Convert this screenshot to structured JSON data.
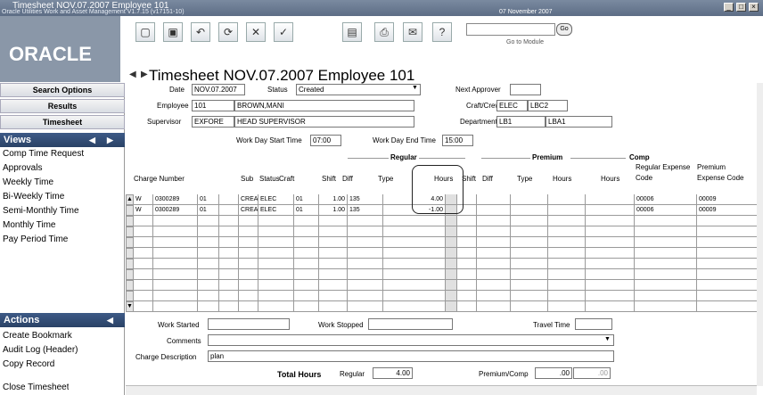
{
  "window": {
    "title": "Timesheet NOV.07.2007 Employee 101",
    "subtitle": "Oracle Utilities Work and Asset Management V1.7.15 (v17151-10)",
    "date": "07 November 2007"
  },
  "logo": "ORACLE",
  "toolbar": {
    "go_label": "Go",
    "go_to_module": "Go to Module"
  },
  "page_title": "Timesheet NOV.07.2007 Employee 101",
  "sidebar": {
    "buttons": [
      "Search Options",
      "Results",
      "Timesheet"
    ],
    "views_label": "Views",
    "views": [
      "Comp Time Request",
      "Approvals",
      "Weekly Time",
      "Bi-Weekly Time",
      "Semi-Monthly Time",
      "Monthly Time",
      "Pay Period Time"
    ],
    "actions_label": "Actions",
    "actions": [
      "Create Bookmark",
      "Audit Log (Header)",
      "Copy Record",
      "Close Timesheet"
    ]
  },
  "form": {
    "date_label": "Date",
    "date": "NOV.07.2007",
    "status_label": "Status",
    "status": "Created",
    "next_approver_label": "Next Approver",
    "next_approver": "",
    "employee_label": "Employee",
    "employee_id": "101",
    "employee_name": "BROWN,MANI",
    "craft_label": "Craft/Crew",
    "craft": "ELEC",
    "crew": "LBC2",
    "supervisor_label": "Supervisor",
    "supervisor_id": "EXFORE",
    "supervisor_name": "HEAD SUPERVISOR",
    "department_label": "Department",
    "department": "LB1",
    "department2": "LBA1",
    "start_label": "Work Day Start Time",
    "start": "07:00",
    "end_label": "Work Day End Time",
    "end": "15:00"
  },
  "grid": {
    "sections": {
      "regular": "Regular",
      "premium": "Premium",
      "comp": "Comp"
    },
    "headers": [
      "Charge Number",
      "Sub",
      "Status",
      "Craft",
      "Shift",
      "Diff",
      "Type",
      "Hours",
      "Shift",
      "Diff",
      "Type",
      "Hours",
      "Hours",
      "Regular Expense Code",
      "Premium Expense Code"
    ],
    "rows": [
      {
        "c0": "W",
        "c1": "0300289",
        "c2": "01",
        "c3": "",
        "c4": "CREA",
        "c5": "ELEC",
        "c6": "01",
        "c7": "1.00",
        "c8": "135",
        "c9": "4.00",
        "c10": "00006",
        "c11": "00009"
      },
      {
        "c0": "W",
        "c1": "0300289",
        "c2": "01",
        "c3": "",
        "c4": "CREA",
        "c5": "ELEC",
        "c6": "01",
        "c7": "1.00",
        "c8": "135",
        "c9": "-1.00",
        "c10": "00006",
        "c11": "00009"
      }
    ]
  },
  "bottom": {
    "work_started_label": "Work Started",
    "work_started": "",
    "work_stopped_label": "Work Stopped",
    "work_stopped": "",
    "travel_label": "Travel Time",
    "travel": "",
    "comments_label": "Comments",
    "comments": "",
    "charge_desc_label": "Charge Description",
    "charge_desc": "plan",
    "total_label": "Total Hours",
    "regular_label": "Regular",
    "regular": "4.00",
    "premium_label": "Premium/Comp",
    "premium": ".00",
    "comp": ".00"
  }
}
